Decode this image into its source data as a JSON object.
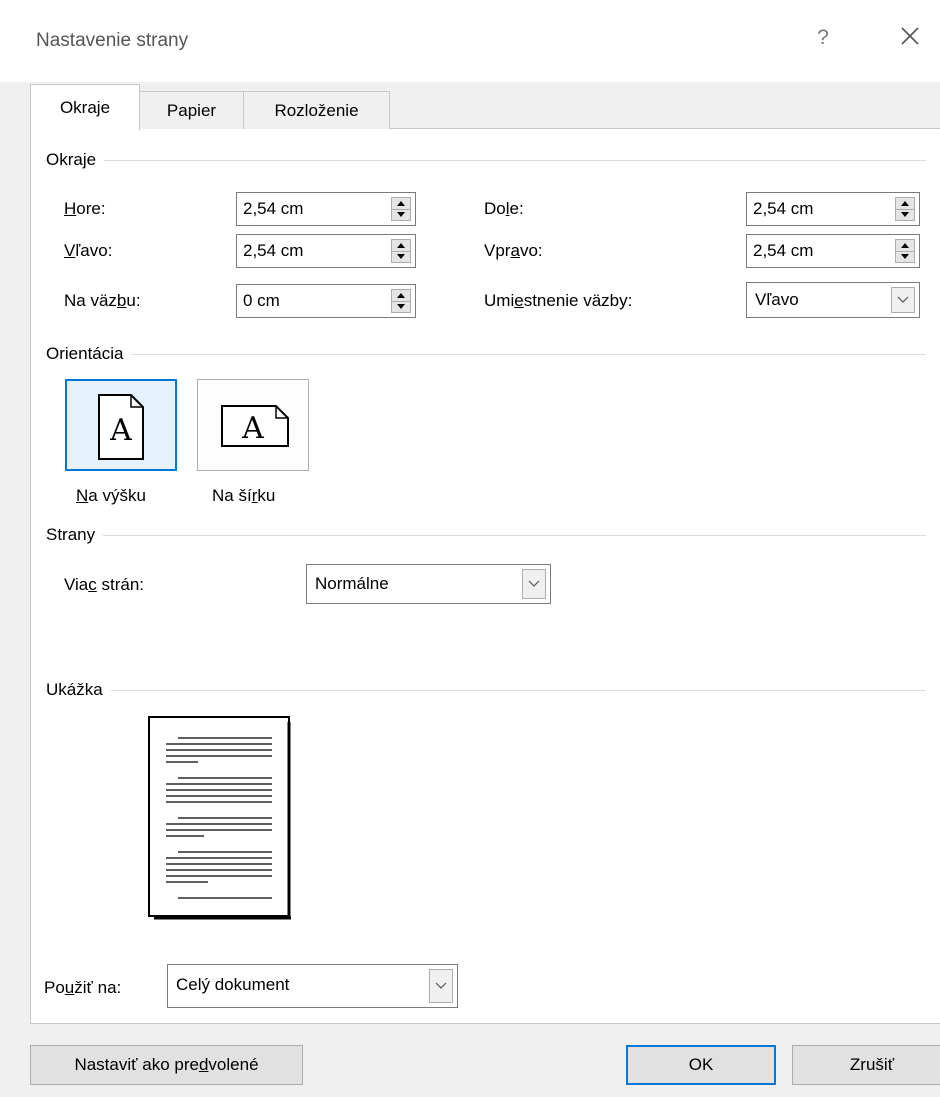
{
  "window": {
    "title": "Nastavenie strany",
    "help_label": "?",
    "close_icon": "close-icon"
  },
  "tabs": [
    {
      "label": "Okraje",
      "active": true
    },
    {
      "label": "Papier",
      "active": false
    },
    {
      "label": "Rozloženie",
      "active": false
    }
  ],
  "margins": {
    "group_label": "Okraje",
    "top": {
      "label": "Hore:",
      "value": "2,54 cm"
    },
    "left": {
      "label": "Vľavo:",
      "value": "2,54 cm"
    },
    "gutter": {
      "label": "Na väzbu:",
      "value": "0 cm"
    },
    "bottom": {
      "label": "Dole:",
      "value": "2,54 cm"
    },
    "right": {
      "label": "Vpravo:",
      "value": "2,54 cm"
    },
    "gutter_position": {
      "label": "Umiestnenie väzby:",
      "value": "Vľavo"
    }
  },
  "orientation": {
    "group_label": "Orientácia",
    "portrait": {
      "label": "Na výšku",
      "selected": true
    },
    "landscape": {
      "label": "Na šírku",
      "selected": false
    },
    "icon_glyph": "A"
  },
  "pages": {
    "group_label": "Strany",
    "multiple_pages": {
      "label": "Viac strán:",
      "value": "Normálne"
    }
  },
  "preview": {
    "group_label": "Ukážka"
  },
  "apply_to": {
    "label": "Použiť na:",
    "value": "Celý dokument"
  },
  "buttons": {
    "set_default": "Nastaviť ako predvolené",
    "ok": "OK",
    "cancel": "Zrušiť"
  },
  "colors": {
    "accent": "#0078d7",
    "dialog_bg": "#f0f0f0",
    "panel_bg": "#ffffff"
  }
}
